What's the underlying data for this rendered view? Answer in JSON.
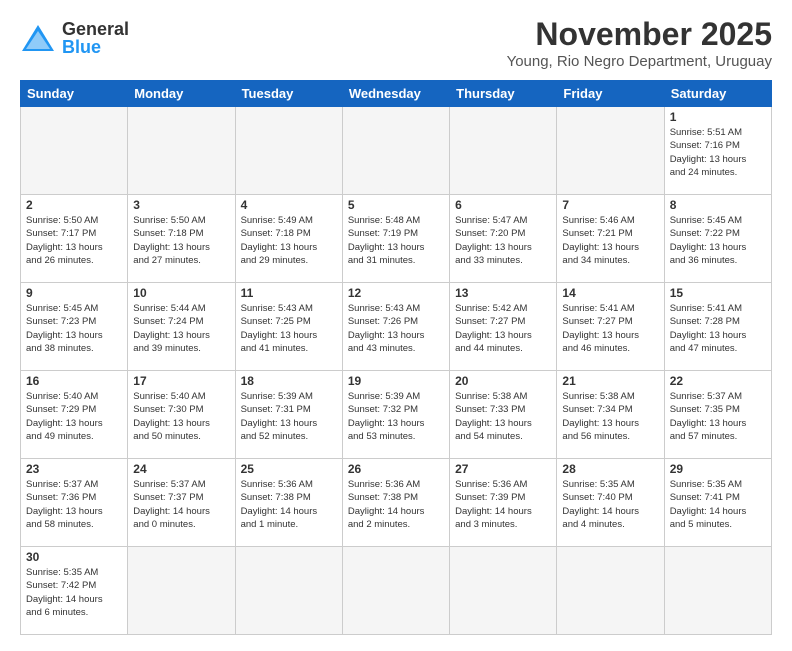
{
  "header": {
    "logo_general": "General",
    "logo_blue": "Blue",
    "month_title": "November 2025",
    "location": "Young, Rio Negro Department, Uruguay"
  },
  "weekdays": [
    "Sunday",
    "Monday",
    "Tuesday",
    "Wednesday",
    "Thursday",
    "Friday",
    "Saturday"
  ],
  "weeks": [
    [
      {
        "day": "",
        "info": "",
        "empty": true
      },
      {
        "day": "",
        "info": "",
        "empty": true
      },
      {
        "day": "",
        "info": "",
        "empty": true
      },
      {
        "day": "",
        "info": "",
        "empty": true
      },
      {
        "day": "",
        "info": "",
        "empty": true
      },
      {
        "day": "",
        "info": "",
        "empty": true
      },
      {
        "day": "1",
        "info": "Sunrise: 5:51 AM\nSunset: 7:16 PM\nDaylight: 13 hours\nand 24 minutes."
      }
    ],
    [
      {
        "day": "2",
        "info": "Sunrise: 5:50 AM\nSunset: 7:17 PM\nDaylight: 13 hours\nand 26 minutes."
      },
      {
        "day": "3",
        "info": "Sunrise: 5:50 AM\nSunset: 7:18 PM\nDaylight: 13 hours\nand 27 minutes."
      },
      {
        "day": "4",
        "info": "Sunrise: 5:49 AM\nSunset: 7:18 PM\nDaylight: 13 hours\nand 29 minutes."
      },
      {
        "day": "5",
        "info": "Sunrise: 5:48 AM\nSunset: 7:19 PM\nDaylight: 13 hours\nand 31 minutes."
      },
      {
        "day": "6",
        "info": "Sunrise: 5:47 AM\nSunset: 7:20 PM\nDaylight: 13 hours\nand 33 minutes."
      },
      {
        "day": "7",
        "info": "Sunrise: 5:46 AM\nSunset: 7:21 PM\nDaylight: 13 hours\nand 34 minutes."
      },
      {
        "day": "8",
        "info": "Sunrise: 5:45 AM\nSunset: 7:22 PM\nDaylight: 13 hours\nand 36 minutes."
      }
    ],
    [
      {
        "day": "9",
        "info": "Sunrise: 5:45 AM\nSunset: 7:23 PM\nDaylight: 13 hours\nand 38 minutes."
      },
      {
        "day": "10",
        "info": "Sunrise: 5:44 AM\nSunset: 7:24 PM\nDaylight: 13 hours\nand 39 minutes."
      },
      {
        "day": "11",
        "info": "Sunrise: 5:43 AM\nSunset: 7:25 PM\nDaylight: 13 hours\nand 41 minutes."
      },
      {
        "day": "12",
        "info": "Sunrise: 5:43 AM\nSunset: 7:26 PM\nDaylight: 13 hours\nand 43 minutes."
      },
      {
        "day": "13",
        "info": "Sunrise: 5:42 AM\nSunset: 7:27 PM\nDaylight: 13 hours\nand 44 minutes."
      },
      {
        "day": "14",
        "info": "Sunrise: 5:41 AM\nSunset: 7:27 PM\nDaylight: 13 hours\nand 46 minutes."
      },
      {
        "day": "15",
        "info": "Sunrise: 5:41 AM\nSunset: 7:28 PM\nDaylight: 13 hours\nand 47 minutes."
      }
    ],
    [
      {
        "day": "16",
        "info": "Sunrise: 5:40 AM\nSunset: 7:29 PM\nDaylight: 13 hours\nand 49 minutes."
      },
      {
        "day": "17",
        "info": "Sunrise: 5:40 AM\nSunset: 7:30 PM\nDaylight: 13 hours\nand 50 minutes."
      },
      {
        "day": "18",
        "info": "Sunrise: 5:39 AM\nSunset: 7:31 PM\nDaylight: 13 hours\nand 52 minutes."
      },
      {
        "day": "19",
        "info": "Sunrise: 5:39 AM\nSunset: 7:32 PM\nDaylight: 13 hours\nand 53 minutes."
      },
      {
        "day": "20",
        "info": "Sunrise: 5:38 AM\nSunset: 7:33 PM\nDaylight: 13 hours\nand 54 minutes."
      },
      {
        "day": "21",
        "info": "Sunrise: 5:38 AM\nSunset: 7:34 PM\nDaylight: 13 hours\nand 56 minutes."
      },
      {
        "day": "22",
        "info": "Sunrise: 5:37 AM\nSunset: 7:35 PM\nDaylight: 13 hours\nand 57 minutes."
      }
    ],
    [
      {
        "day": "23",
        "info": "Sunrise: 5:37 AM\nSunset: 7:36 PM\nDaylight: 13 hours\nand 58 minutes."
      },
      {
        "day": "24",
        "info": "Sunrise: 5:37 AM\nSunset: 7:37 PM\nDaylight: 14 hours\nand 0 minutes."
      },
      {
        "day": "25",
        "info": "Sunrise: 5:36 AM\nSunset: 7:38 PM\nDaylight: 14 hours\nand 1 minute."
      },
      {
        "day": "26",
        "info": "Sunrise: 5:36 AM\nSunset: 7:38 PM\nDaylight: 14 hours\nand 2 minutes."
      },
      {
        "day": "27",
        "info": "Sunrise: 5:36 AM\nSunset: 7:39 PM\nDaylight: 14 hours\nand 3 minutes."
      },
      {
        "day": "28",
        "info": "Sunrise: 5:35 AM\nSunset: 7:40 PM\nDaylight: 14 hours\nand 4 minutes."
      },
      {
        "day": "29",
        "info": "Sunrise: 5:35 AM\nSunset: 7:41 PM\nDaylight: 14 hours\nand 5 minutes."
      }
    ],
    [
      {
        "day": "30",
        "info": "Sunrise: 5:35 AM\nSunset: 7:42 PM\nDaylight: 14 hours\nand 6 minutes."
      },
      {
        "day": "",
        "info": "",
        "empty": true
      },
      {
        "day": "",
        "info": "",
        "empty": true
      },
      {
        "day": "",
        "info": "",
        "empty": true
      },
      {
        "day": "",
        "info": "",
        "empty": true
      },
      {
        "day": "",
        "info": "",
        "empty": true
      },
      {
        "day": "",
        "info": "",
        "empty": true
      }
    ]
  ]
}
